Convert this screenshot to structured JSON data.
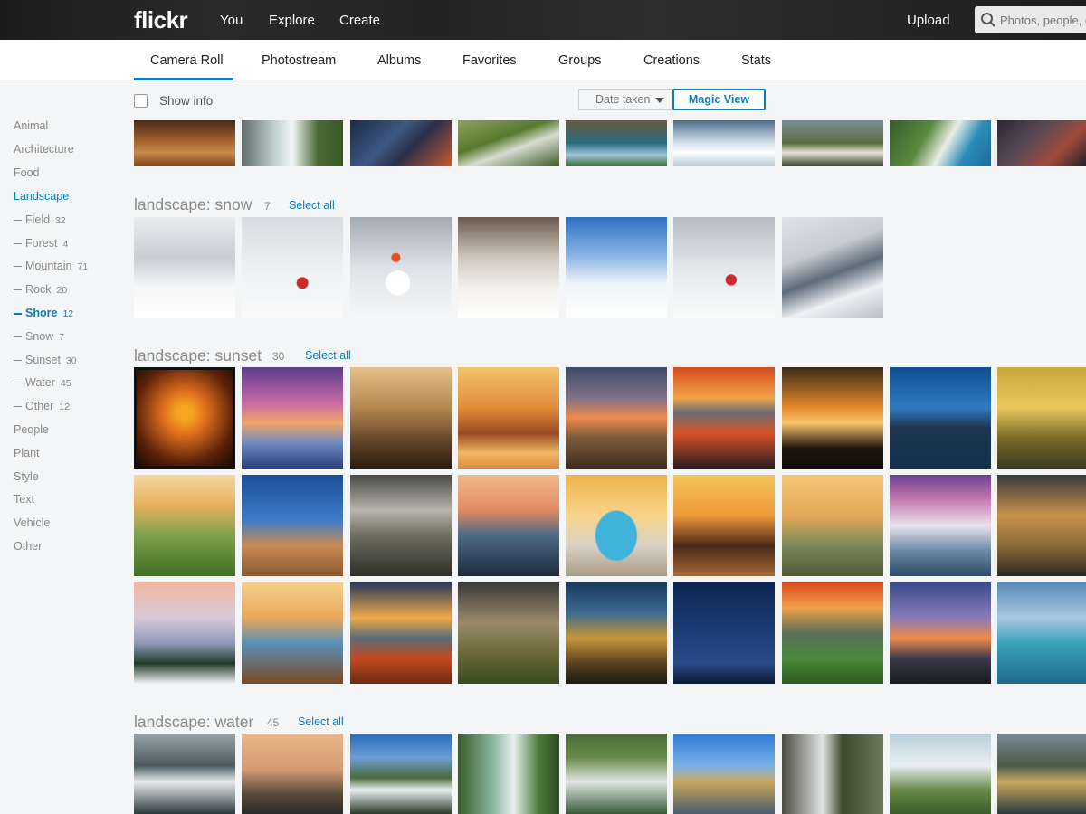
{
  "header": {
    "logo": "flickr",
    "nav": [
      "You",
      "Explore",
      "Create"
    ],
    "upload": "Upload",
    "search_placeholder": "Photos, people, or groups"
  },
  "subnav": {
    "tabs": [
      "Camera Roll",
      "Photostream",
      "Albums",
      "Favorites",
      "Groups",
      "Creations",
      "Stats"
    ],
    "active": "Camera Roll"
  },
  "toolbar": {
    "show_info": "Show info",
    "sort": "Date taken",
    "view": "Magic View"
  },
  "sidebar": {
    "items": [
      {
        "label": "Animal",
        "count": ""
      },
      {
        "label": "Architecture",
        "count": ""
      },
      {
        "label": "Food",
        "count": ""
      },
      {
        "label": "Landscape",
        "count": ""
      },
      {
        "label": "Field",
        "count": "32"
      },
      {
        "label": "Forest",
        "count": "4"
      },
      {
        "label": "Mountain",
        "count": "71"
      },
      {
        "label": "Rock",
        "count": "20"
      },
      {
        "label": "Shore",
        "count": "12"
      },
      {
        "label": "Snow",
        "count": "7"
      },
      {
        "label": "Sunset",
        "count": "30"
      },
      {
        "label": "Water",
        "count": "45"
      },
      {
        "label": "Other",
        "count": "12"
      },
      {
        "label": "People",
        "count": ""
      },
      {
        "label": "Plant",
        "count": ""
      },
      {
        "label": "Style",
        "count": ""
      },
      {
        "label": "Text",
        "count": ""
      },
      {
        "label": "Vehicle",
        "count": ""
      },
      {
        "label": "Other",
        "count": ""
      }
    ]
  },
  "sections": [
    {
      "title": "landscape: snow",
      "count": "7",
      "select_all": "Select all"
    },
    {
      "title": "landscape: sunset",
      "count": "30",
      "select_all": "Select all"
    },
    {
      "title": "landscape: water",
      "count": "45",
      "select_all": "Select all"
    }
  ],
  "colors": {
    "accent": "#0a7dba",
    "topbar": "#222222",
    "page_bg": "#f3f5f6"
  }
}
